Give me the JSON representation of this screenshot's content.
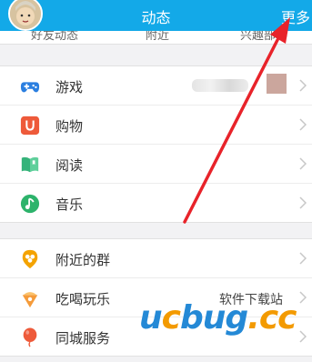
{
  "header": {
    "title": "动态",
    "more_label": "更多"
  },
  "subtabs": {
    "items": [
      "好友动态",
      "附近",
      "兴趣部落"
    ]
  },
  "groups": [
    {
      "items": [
        {
          "label": "游戏",
          "icon": "gamepad-icon",
          "color": "#2b7fe0"
        },
        {
          "label": "购物",
          "icon": "shopping-bag-icon",
          "color": "#ee5a3a"
        },
        {
          "label": "阅读",
          "icon": "book-icon",
          "color": "#35b37a"
        },
        {
          "label": "音乐",
          "icon": "music-note-icon",
          "color": "#2db36b"
        }
      ]
    },
    {
      "items": [
        {
          "label": "附近的群",
          "icon": "nearby-group-icon",
          "color": "#f4a300"
        },
        {
          "label": "吃喝玩乐",
          "icon": "food-fun-icon",
          "color": "#f59b3a"
        },
        {
          "label": "同城服务",
          "icon": "balloon-icon",
          "color": "#ee5a3a"
        }
      ]
    }
  ],
  "watermark": {
    "small_text": "软件下载站",
    "u": "u",
    "c": "c",
    "bug": "bug",
    "dotcc": ".cc"
  },
  "colors": {
    "header_bg": "#13a9e8",
    "arrow": "#e8232a"
  }
}
